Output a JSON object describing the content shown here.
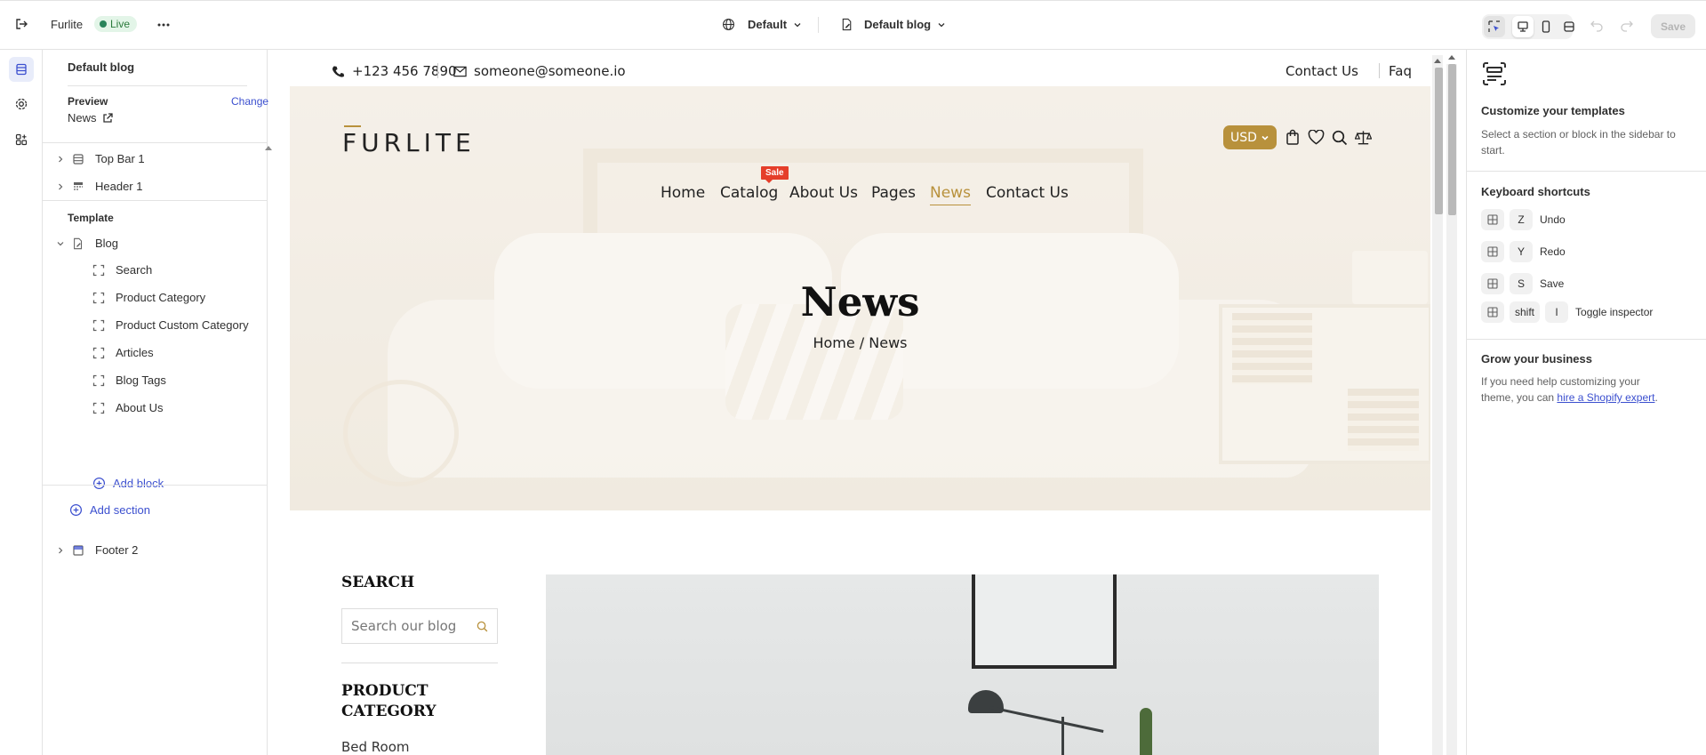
{
  "topbar": {
    "store_name": "Furlite",
    "status": "Live",
    "theme_selector": "Default",
    "template_selector": "Default blog",
    "save_label": "Save"
  },
  "sidebar": {
    "title": "Default blog",
    "preview_label": "Preview",
    "change_label": "Change",
    "preview_page": "News",
    "sections_top": [
      {
        "label": "Top Bar 1",
        "icon": "layout-icon"
      },
      {
        "label": "Header 1",
        "icon": "header-icon"
      }
    ],
    "template_heading": "Template",
    "template_group": "Blog",
    "blocks": [
      "Search",
      "Product Category",
      "Product Custom Category",
      "Articles",
      "Blog Tags",
      "About Us"
    ],
    "add_block": "Add block",
    "add_section": "Add section",
    "footer": "Footer 2"
  },
  "store": {
    "phone": "+123 456 7890",
    "email": "someone@someone.io",
    "top_links": [
      "Contact Us",
      "Faq"
    ],
    "logo": "FURLITE",
    "nav": [
      "Home",
      "Catalog",
      "About Us",
      "Pages",
      "News",
      "Contact Us"
    ],
    "nav_active": "News",
    "sale_badge": "Sale",
    "currency": "USD",
    "hero_title": "News",
    "breadcrumb": "Home / News",
    "search_heading": "SEARCH",
    "search_placeholder": "Search our blog",
    "category_heading": "PRODUCT CATEGORY",
    "category_first": "Bed Room",
    "accent_color": "#b8913c"
  },
  "inspector": {
    "title": "Customize your templates",
    "subtitle": "Select a section or block in the sidebar to start.",
    "shortcuts_title": "Keyboard shortcuts",
    "shortcuts": [
      {
        "keys": [
          "Z"
        ],
        "action": "Undo"
      },
      {
        "keys": [
          "Y"
        ],
        "action": "Redo"
      },
      {
        "keys": [
          "S"
        ],
        "action": "Save"
      },
      {
        "keys": [
          "shift",
          "I"
        ],
        "action": "Toggle inspector"
      }
    ],
    "grow_title": "Grow your business",
    "grow_text": "If you need help customizing your theme, you can",
    "grow_link": "hire a Shopify expert",
    "grow_end": "."
  }
}
